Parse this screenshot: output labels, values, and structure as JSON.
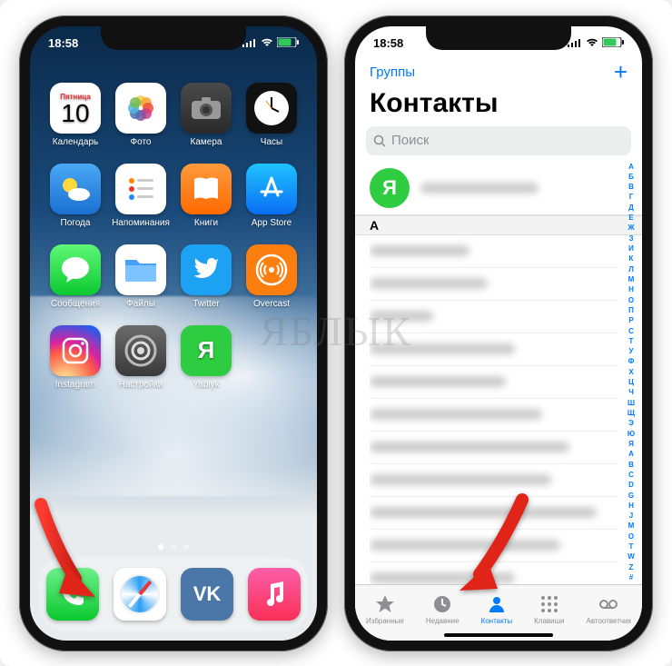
{
  "statusbar": {
    "time": "18:58"
  },
  "home": {
    "calendar": {
      "dayOfWeek": "Пятница",
      "dayNum": "10"
    },
    "apps": [
      {
        "label": "Календарь"
      },
      {
        "label": "Фото"
      },
      {
        "label": "Камера"
      },
      {
        "label": "Часы"
      },
      {
        "label": "Погода"
      },
      {
        "label": "Напоминания"
      },
      {
        "label": "Книги"
      },
      {
        "label": "App Store"
      },
      {
        "label": "Сообщения"
      },
      {
        "label": "Файлы"
      },
      {
        "label": "Twitter"
      },
      {
        "label": "Overcast"
      },
      {
        "label": "Instagram"
      },
      {
        "label": "Настройки"
      },
      {
        "label": "Yablyk"
      }
    ],
    "yablykGlyph": "Я"
  },
  "contacts": {
    "groups": "Группы",
    "add": "+",
    "title": "Контакты",
    "searchPlaceholder": "Поиск",
    "myCardGlyph": "Я",
    "sectionA": "А",
    "index": [
      "А",
      "Б",
      "В",
      "Г",
      "Д",
      "Е",
      "Ж",
      "З",
      "И",
      "К",
      "Л",
      "М",
      "Н",
      "О",
      "П",
      "Р",
      "С",
      "Т",
      "У",
      "Ф",
      "Х",
      "Ц",
      "Ч",
      "Ш",
      "Щ",
      "Э",
      "Ю",
      "Я",
      "A",
      "B",
      "C",
      "D",
      "G",
      "H",
      "J",
      "M",
      "O",
      "T",
      "W",
      "Z",
      "#"
    ],
    "tabs": [
      {
        "label": "Избранные"
      },
      {
        "label": "Недавние"
      },
      {
        "label": "Контакты"
      },
      {
        "label": "Клавиши"
      },
      {
        "label": "Автоответчик"
      }
    ]
  },
  "watermark": "ЯБЛЫК"
}
